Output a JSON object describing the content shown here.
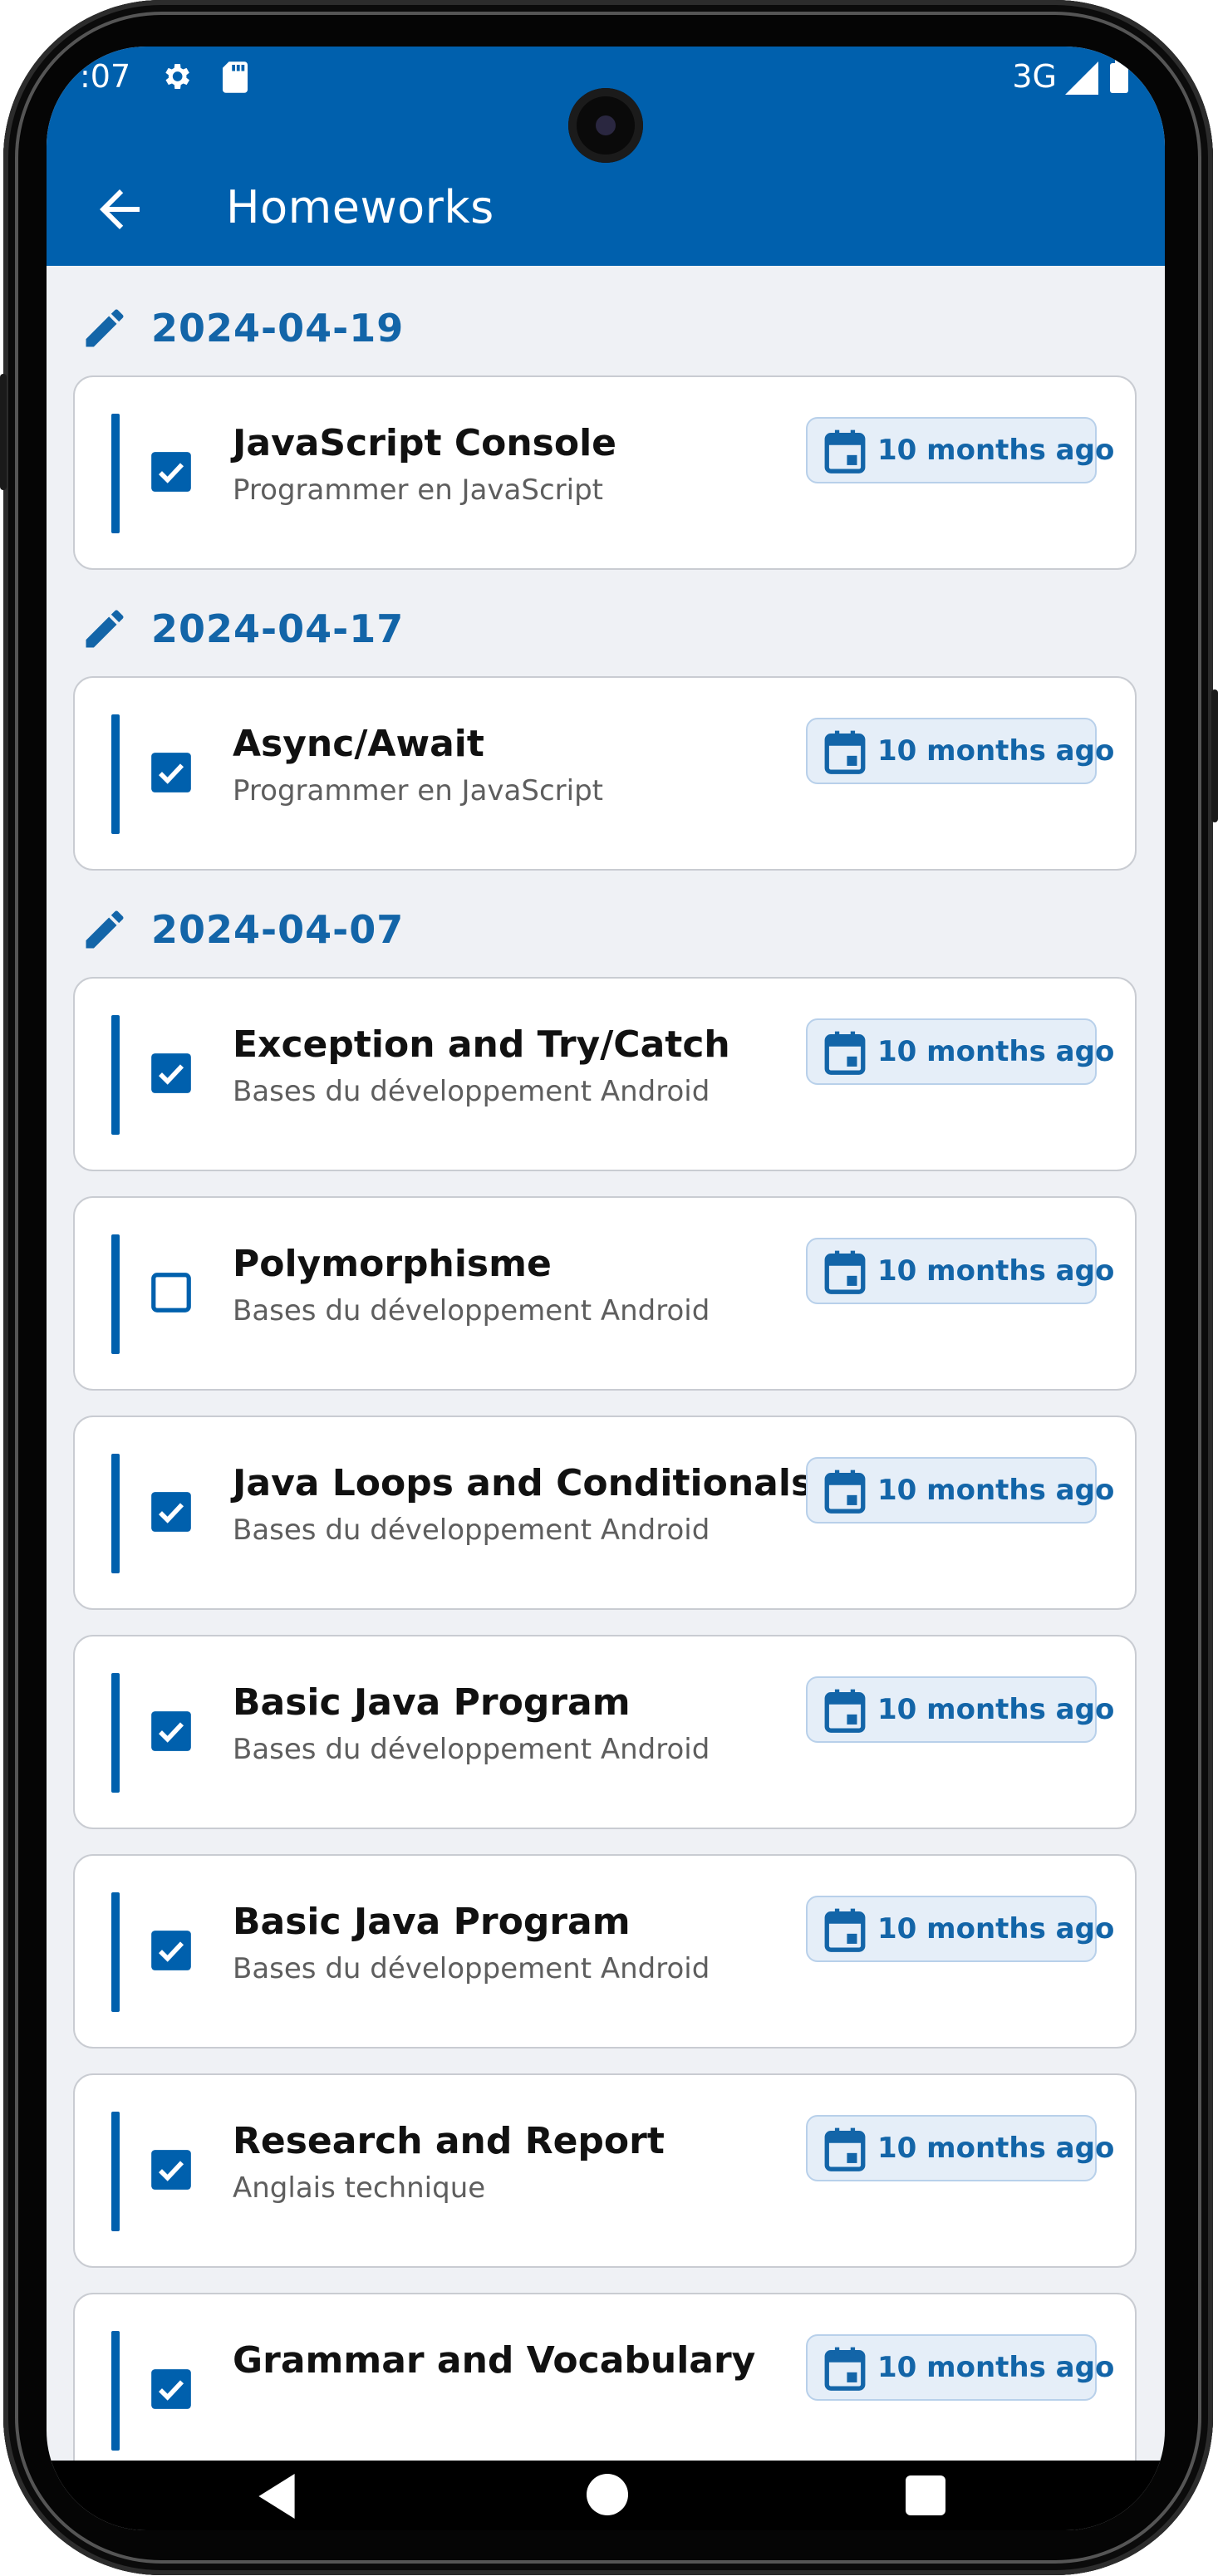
{
  "status_bar": {
    "time": ":07",
    "network": "3G",
    "icons": [
      "gear-icon",
      "sd-card-icon",
      "signal-icon",
      "battery-icon"
    ]
  },
  "app_bar": {
    "title": "Homeworks",
    "back_icon": "arrow-left-icon"
  },
  "colors": {
    "primary": "#0060ad",
    "accent_text": "#1365a8",
    "background": "#eff1f5",
    "badge_bg": "#e5eef8"
  },
  "groups": [
    {
      "date": "2024-04-19",
      "icon": "pencil-icon",
      "items": [
        {
          "title": "JavaScript Console",
          "course": "Programmer en JavaScript",
          "done": true,
          "when": "10 months ago"
        }
      ]
    },
    {
      "date": "2024-04-17",
      "icon": "pencil-icon",
      "items": [
        {
          "title": "Async/Await",
          "course": "Programmer en JavaScript",
          "done": true,
          "when": "10 months ago"
        }
      ]
    },
    {
      "date": "2024-04-07",
      "icon": "pencil-icon",
      "items": [
        {
          "title": "Exception and Try/Catch",
          "course": "Bases du développement Android",
          "done": true,
          "when": "10 months ago"
        },
        {
          "title": "Polymorphisme",
          "course": "Bases du développement Android",
          "done": false,
          "when": "10 months ago"
        },
        {
          "title": "Java Loops and Conditionals",
          "course": "Bases du développement Android",
          "done": true,
          "when": "10 months ago"
        },
        {
          "title": "Basic Java Program",
          "course": "Bases du développement Android",
          "done": true,
          "when": "10 months ago"
        },
        {
          "title": "Basic Java Program",
          "course": "Bases du développement Android",
          "done": true,
          "when": "10 months ago"
        },
        {
          "title": "Research and Report",
          "course": "Anglais technique",
          "done": true,
          "when": "10 months ago"
        },
        {
          "title": "Grammar and Vocabulary",
          "course": "",
          "done": true,
          "when": "10 months ago"
        }
      ]
    }
  ],
  "nav_bar": {
    "icons": [
      "back-triangle-icon",
      "home-circle-icon",
      "recents-square-icon"
    ]
  }
}
